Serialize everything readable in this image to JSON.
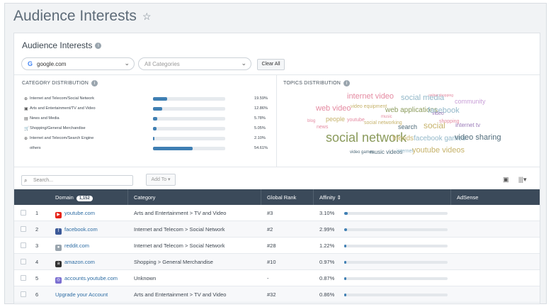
{
  "page": {
    "title": "Audience Interests"
  },
  "card": {
    "title": "Audience Interests"
  },
  "filters": {
    "domain_value": "google.com",
    "category_placeholder": "All Categories",
    "clear_label": "Clear All"
  },
  "category_distribution": {
    "title": "CATEGORY DISTRIBUTION",
    "rows": [
      {
        "icon": "globe-icon",
        "label": "Internet and Telecom/Social Network",
        "value": "19.59%",
        "fraction": 0.2
      },
      {
        "icon": "film-icon",
        "label": "Arts and Entertainment/TV and Video",
        "value": "12.86%",
        "fraction": 0.13
      },
      {
        "icon": "news-icon",
        "label": "News and Media",
        "value": "5.78%",
        "fraction": 0.06
      },
      {
        "icon": "cart-icon",
        "label": "Shopping/General Merchandise",
        "value": "5.05%",
        "fraction": 0.05
      },
      {
        "icon": "globe-icon",
        "label": "Internet and Telecom/Search Engine",
        "value": "2.10%",
        "fraction": 0.02
      },
      {
        "icon": "",
        "label": "others",
        "value": "54.61%",
        "fraction": 0.55
      }
    ]
  },
  "topics": {
    "title": "TOPICS DISTRIBUTION",
    "words": [
      "internet video",
      "social media",
      "web video",
      "video equipment",
      "web applications",
      "facebook",
      "community",
      "people",
      "youtube",
      "social networking",
      "search",
      "social",
      "shopping",
      "internet tv",
      "news",
      "social network",
      "friends",
      "facebook games",
      "video sharing",
      "video games",
      "music videos",
      "internet",
      "youtube videos",
      "music",
      "video",
      "blog",
      "online shopping"
    ]
  },
  "toolbar": {
    "search_placeholder": "Search...",
    "add_to_label": "Add To ▾"
  },
  "table": {
    "headers": {
      "domain": "Domain",
      "count": "1,152",
      "category": "Category",
      "rank": "Global Rank",
      "affinity": "Affinity ⇕",
      "adsense": "AdSense"
    },
    "rows": [
      {
        "num": "1",
        "icon": "youtube-icon",
        "color": "#e62117",
        "domain": "youtube.com",
        "category": "Arts and Entertainment > TV and Video",
        "rank": "#3",
        "affinity": "3.10%",
        "fraction": 0.031
      },
      {
        "num": "2",
        "icon": "facebook-icon",
        "color": "#3b5998",
        "domain": "facebook.com",
        "category": "Internet and Telecom > Social Network",
        "rank": "#2",
        "affinity": "2.99%",
        "fraction": 0.0299
      },
      {
        "num": "3",
        "icon": "reddit-icon",
        "color": "#9aa5ae",
        "domain": "reddit.com",
        "category": "Internet and Telecom > Social Network",
        "rank": "#28",
        "affinity": "1.22%",
        "fraction": 0.0122
      },
      {
        "num": "4",
        "icon": "amazon-icon",
        "color": "#333333",
        "domain": "amazon.com",
        "category": "Shopping > General Merchandise",
        "rank": "#10",
        "affinity": "0.97%",
        "fraction": 0.0097
      },
      {
        "num": "5",
        "icon": "accounts-icon",
        "color": "#7b6fd1",
        "domain": "accounts.youtube.com",
        "category": "Unknown",
        "rank": "-",
        "affinity": "0.87%",
        "fraction": 0.0087
      },
      {
        "num": "6",
        "icon": "",
        "color": "",
        "domain": "Upgrade your Account",
        "category": "Arts and Entertainment > TV and Video",
        "rank": "#32",
        "affinity": "0.86%",
        "fraction": 0.0086
      }
    ]
  }
}
